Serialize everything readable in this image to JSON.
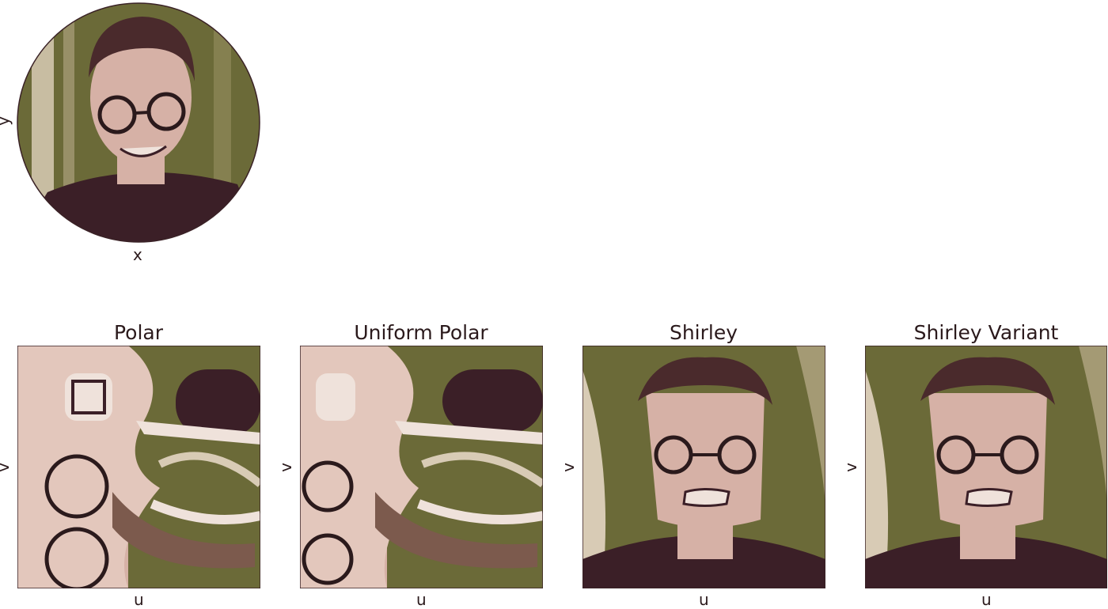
{
  "source": {
    "xlabel": "x",
    "ylabel": "y"
  },
  "panels": [
    {
      "title": "Polar",
      "xlabel": "u",
      "ylabel": "v"
    },
    {
      "title": "Uniform Polar",
      "xlabel": "u",
      "ylabel": "v"
    },
    {
      "title": "Shirley",
      "xlabel": "u",
      "ylabel": "v"
    },
    {
      "title": "Shirley Variant",
      "xlabel": "u",
      "ylabel": "v"
    }
  ],
  "colors": {
    "text": "#2b1a1c",
    "border": "#3a2226",
    "olive": "#6b6a38",
    "dark_maroon": "#3b1f27",
    "skin": "#d6b1a6",
    "light": "#efe2db"
  }
}
